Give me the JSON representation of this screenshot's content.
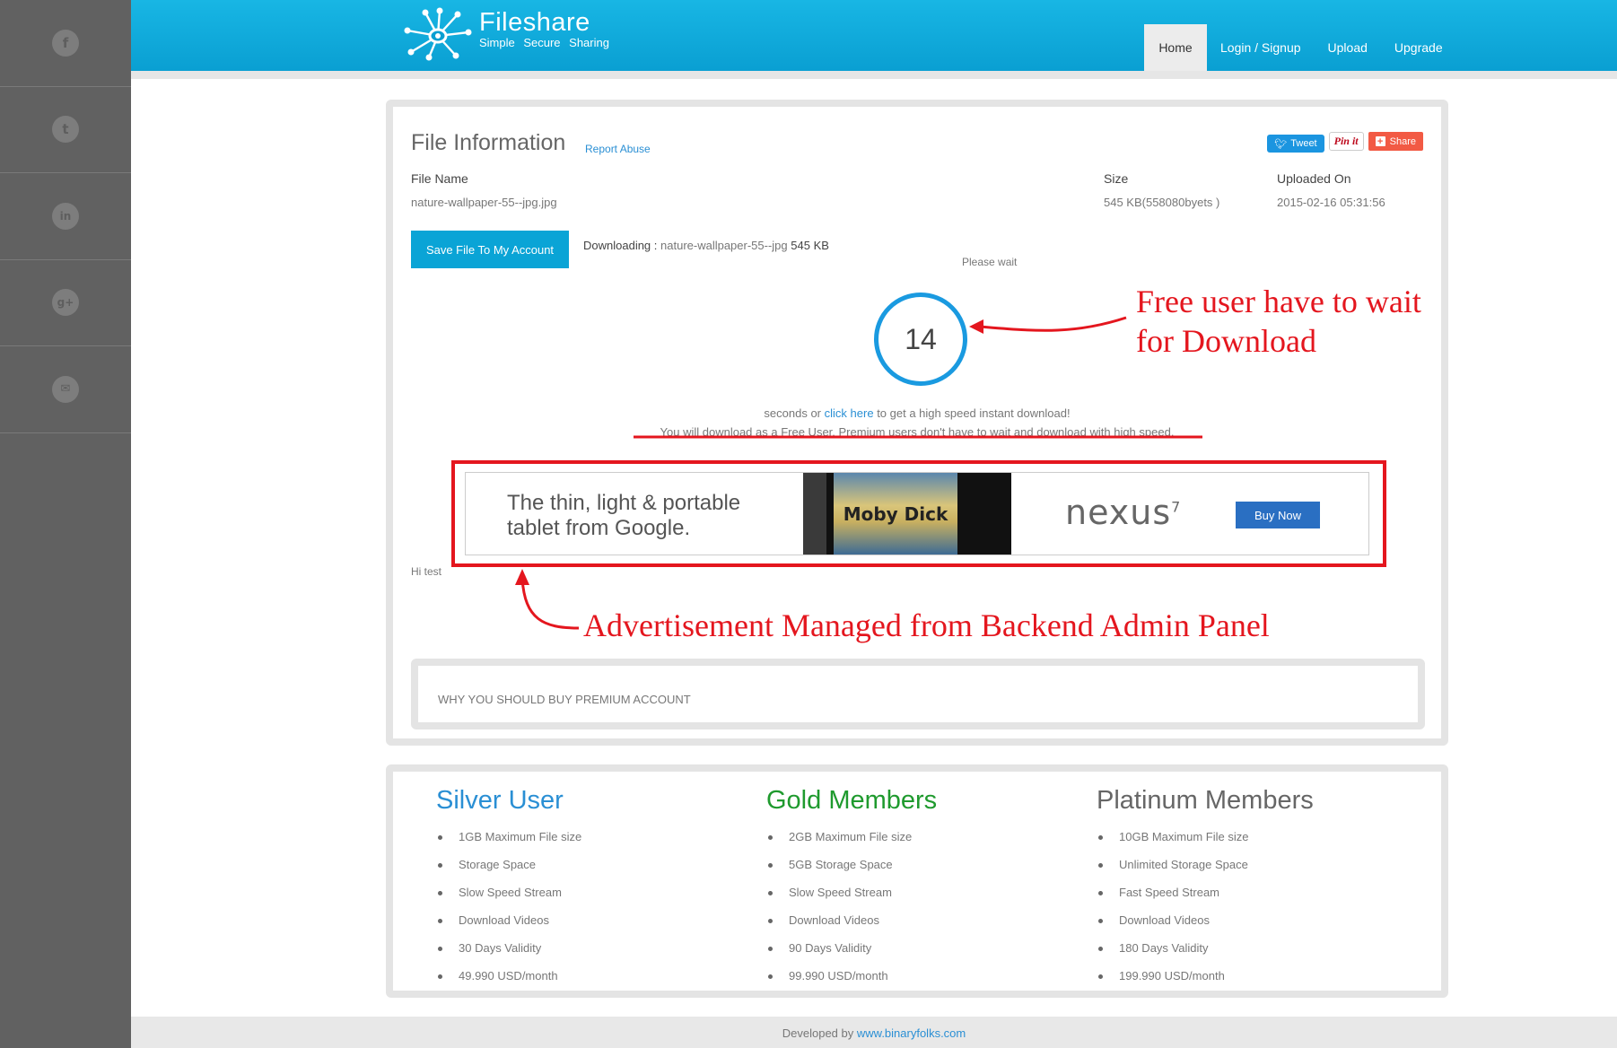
{
  "sidebar": {
    "social_icons": [
      {
        "name": "facebook-icon",
        "glyph": "f"
      },
      {
        "name": "twitter-icon",
        "glyph": "t"
      },
      {
        "name": "linkedin-icon",
        "glyph": "in"
      },
      {
        "name": "googleplus-icon",
        "glyph": "g+"
      },
      {
        "name": "mail-icon",
        "glyph": "✉"
      }
    ]
  },
  "header": {
    "logo_title": "Fileshare",
    "logo_tagline": "Simple  Secure  Sharing",
    "nav": {
      "home": "Home",
      "login": "Login / Signup",
      "upload": "Upload",
      "upgrade": "Upgrade"
    },
    "active_nav": "home"
  },
  "file_info": {
    "title": "File Information",
    "report_link": "Report Abuse",
    "share": {
      "tweet": "Tweet",
      "pinit": "Pin it",
      "share": "Share"
    },
    "labels": {
      "file_name": "File Name",
      "size": "Size",
      "uploaded_on": "Uploaded On"
    },
    "file_name": "nature-wallpaper-55--jpg.jpg",
    "size": "545 KB(558080byets )",
    "uploaded_on": "2015-02-16 05:31:56",
    "save_button": "Save File To My Account",
    "downloading_label": "Downloading :",
    "downloading_file": "nature-wallpaper-55--jpg",
    "downloading_size": "545 KB",
    "please_wait": "Please wait",
    "countdown": "14",
    "seconds_prefix": "seconds or",
    "click_here": "click here",
    "seconds_suffix": "to get a high speed instant download!",
    "free_user_notice": "You will download as a Free User. Premium users don't have to wait and download with high speed.",
    "hi_test": "Hi test",
    "why_premium": "WHY YOU SHOULD BUY PREMIUM ACCOUNT"
  },
  "ad": {
    "copy_line1": "The thin, light & portable",
    "copy_line2": "tablet from Google.",
    "book_title": "Moby Dick",
    "brand": "nexus",
    "brand_superscript": "7",
    "buy_now": "Buy Now"
  },
  "annotations": {
    "wait_line1": "Free user have to wait",
    "wait_line2": "for Download",
    "ad_note": "Advertisement Managed from Backend Admin Panel",
    "color": "#e4161e"
  },
  "plans": [
    {
      "title": "Silver User",
      "color": "#2a8fd4",
      "features": [
        "1GB Maximum File size",
        "Storage Space",
        "Slow Speed Stream",
        "Download Videos",
        "30 Days Validity",
        "49.990 USD/month"
      ]
    },
    {
      "title": "Gold Members",
      "color": "#1f9a2e",
      "features": [
        "2GB Maximum File size",
        "5GB Storage Space",
        "Slow Speed Stream",
        "Download Videos",
        "90 Days Validity",
        "99.990 USD/month"
      ]
    },
    {
      "title": "Platinum Members",
      "color": "#666666",
      "features": [
        "10GB Maximum File size",
        "Unlimited Storage Space",
        "Fast Speed Stream",
        "Download Videos",
        "180 Days Validity",
        "199.990 USD/month"
      ]
    }
  ],
  "footer": {
    "prefix": "Developed by",
    "link": "www.binaryfolks.com"
  }
}
